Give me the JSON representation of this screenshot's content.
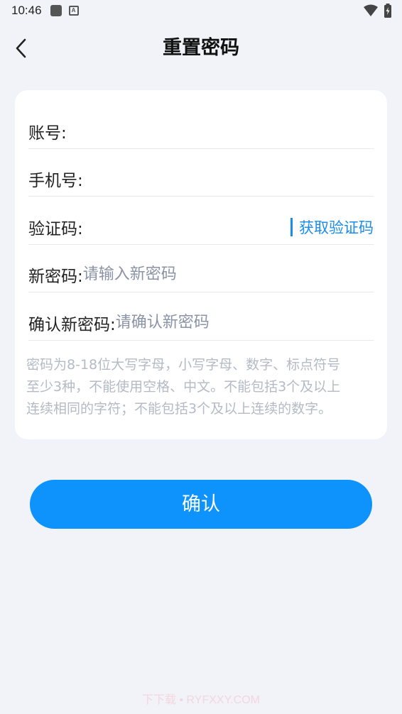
{
  "status_bar": {
    "time": "10:46",
    "icons": [
      "app-notification-icon",
      "a-notification-icon",
      "wifi-icon",
      "battery-icon"
    ]
  },
  "header": {
    "title": "重置密码",
    "back_icon": "chevron-left-icon"
  },
  "form": {
    "account_label": "账号:",
    "phone_label": "手机号:",
    "code_label": "验证码:",
    "get_code_button": "获取验证码",
    "new_password_label": "新密码:",
    "new_password_placeholder": "请输入新密码",
    "confirm_password_label": "确认新密码:",
    "confirm_password_placeholder": "请确认新密码",
    "hint_lines": [
      "密码为8-18位大写字母，小写字母、数字、标点符号",
      "至少3种，不能使用空格、中文。不能包括3个及以上",
      "连续相同的字符；不能包括3个及以上连续的数字。"
    ]
  },
  "confirm_button": "确认",
  "watermark": "下下载 • RYFXXY.COM",
  "colors": {
    "accent": "#0d93fb",
    "link": "#1a8cf0",
    "background": "#f1f3f9",
    "hint": "#b4bac6"
  }
}
